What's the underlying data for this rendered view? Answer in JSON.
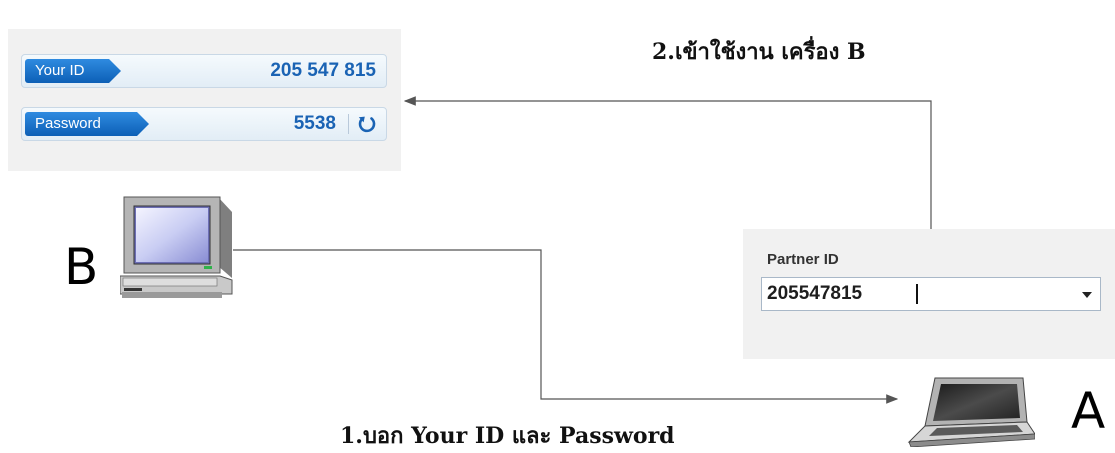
{
  "id_panel": {
    "your_id_label": "Your ID",
    "your_id_value": "205 547 815",
    "password_label": "Password",
    "password_value": "5538"
  },
  "partner_panel": {
    "label": "Partner ID",
    "value": "205547815"
  },
  "captions": {
    "step1": "1.บอก Your ID และ Password",
    "step2": "2.เข้าใช้งาน เครื่อง B"
  },
  "machines": {
    "b_label": "B",
    "a_label": "A"
  },
  "colors": {
    "tag_blue": "#0c5fb6",
    "value_blue": "#1a63b4",
    "connector": "#555555"
  },
  "icons": [
    "refresh-icon",
    "desktop-computer-icon",
    "laptop-icon",
    "dropdown-arrow-icon"
  ]
}
